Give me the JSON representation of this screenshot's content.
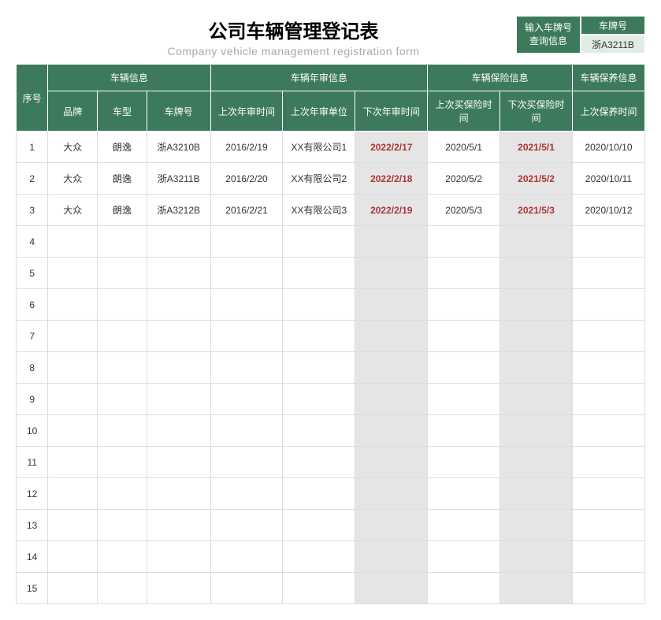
{
  "title": "公司车辆管理登记表",
  "subtitle": "Company vehicle management registration form",
  "search": {
    "label": "输入车牌号\n查询信息",
    "label_line1": "输入车牌号",
    "label_line2": "查询信息",
    "header": "车牌号",
    "value": "浙A3211B"
  },
  "headers": {
    "seq": "序号",
    "vehicle_info": "车辆信息",
    "inspection_info": "车辆年审信息",
    "insurance_info": "车辆保险信息",
    "maintenance_info": "车辆保养信息",
    "brand": "品牌",
    "model": "车型",
    "plate": "车牌号",
    "last_inspection_date": "上次年审时间",
    "last_inspection_unit": "上次年审单位",
    "next_inspection_date": "下次年审时间",
    "last_insurance_date": "上次买保险时间",
    "next_insurance_date": "下次买保险时间",
    "last_maintenance_date": "上次保养时间"
  },
  "rows": [
    {
      "seq": "1",
      "brand": "大众",
      "model": "朗逸",
      "plate": "浙A3210B",
      "last_insp_date": "2016/2/19",
      "last_insp_unit": "XX有限公司1",
      "next_insp_date": "2022/2/17",
      "last_ins_date": "2020/5/1",
      "next_ins_date": "2021/5/1",
      "last_maint": "2020/10/10"
    },
    {
      "seq": "2",
      "brand": "大众",
      "model": "朗逸",
      "plate": "浙A3211B",
      "last_insp_date": "2016/2/20",
      "last_insp_unit": "XX有限公司2",
      "next_insp_date": "2022/2/18",
      "last_ins_date": "2020/5/2",
      "next_ins_date": "2021/5/2",
      "last_maint": "2020/10/11"
    },
    {
      "seq": "3",
      "brand": "大众",
      "model": "朗逸",
      "plate": "浙A3212B",
      "last_insp_date": "2016/2/21",
      "last_insp_unit": "XX有限公司3",
      "next_insp_date": "2022/2/19",
      "last_ins_date": "2020/5/3",
      "next_ins_date": "2021/5/3",
      "last_maint": "2020/10/12"
    },
    {
      "seq": "4",
      "brand": "",
      "model": "",
      "plate": "",
      "last_insp_date": "",
      "last_insp_unit": "",
      "next_insp_date": "",
      "last_ins_date": "",
      "next_ins_date": "",
      "last_maint": ""
    },
    {
      "seq": "5",
      "brand": "",
      "model": "",
      "plate": "",
      "last_insp_date": "",
      "last_insp_unit": "",
      "next_insp_date": "",
      "last_ins_date": "",
      "next_ins_date": "",
      "last_maint": ""
    },
    {
      "seq": "6",
      "brand": "",
      "model": "",
      "plate": "",
      "last_insp_date": "",
      "last_insp_unit": "",
      "next_insp_date": "",
      "last_ins_date": "",
      "next_ins_date": "",
      "last_maint": ""
    },
    {
      "seq": "7",
      "brand": "",
      "model": "",
      "plate": "",
      "last_insp_date": "",
      "last_insp_unit": "",
      "next_insp_date": "",
      "last_ins_date": "",
      "next_ins_date": "",
      "last_maint": ""
    },
    {
      "seq": "8",
      "brand": "",
      "model": "",
      "plate": "",
      "last_insp_date": "",
      "last_insp_unit": "",
      "next_insp_date": "",
      "last_ins_date": "",
      "next_ins_date": "",
      "last_maint": ""
    },
    {
      "seq": "9",
      "brand": "",
      "model": "",
      "plate": "",
      "last_insp_date": "",
      "last_insp_unit": "",
      "next_insp_date": "",
      "last_ins_date": "",
      "next_ins_date": "",
      "last_maint": ""
    },
    {
      "seq": "10",
      "brand": "",
      "model": "",
      "plate": "",
      "last_insp_date": "",
      "last_insp_unit": "",
      "next_insp_date": "",
      "last_ins_date": "",
      "next_ins_date": "",
      "last_maint": ""
    },
    {
      "seq": "11",
      "brand": "",
      "model": "",
      "plate": "",
      "last_insp_date": "",
      "last_insp_unit": "",
      "next_insp_date": "",
      "last_ins_date": "",
      "next_ins_date": "",
      "last_maint": ""
    },
    {
      "seq": "12",
      "brand": "",
      "model": "",
      "plate": "",
      "last_insp_date": "",
      "last_insp_unit": "",
      "next_insp_date": "",
      "last_ins_date": "",
      "next_ins_date": "",
      "last_maint": ""
    },
    {
      "seq": "13",
      "brand": "",
      "model": "",
      "plate": "",
      "last_insp_date": "",
      "last_insp_unit": "",
      "next_insp_date": "",
      "last_ins_date": "",
      "next_ins_date": "",
      "last_maint": ""
    },
    {
      "seq": "14",
      "brand": "",
      "model": "",
      "plate": "",
      "last_insp_date": "",
      "last_insp_unit": "",
      "next_insp_date": "",
      "last_ins_date": "",
      "next_ins_date": "",
      "last_maint": ""
    },
    {
      "seq": "15",
      "brand": "",
      "model": "",
      "plate": "",
      "last_insp_date": "",
      "last_insp_unit": "",
      "next_insp_date": "",
      "last_ins_date": "",
      "next_ins_date": "",
      "last_maint": ""
    }
  ]
}
